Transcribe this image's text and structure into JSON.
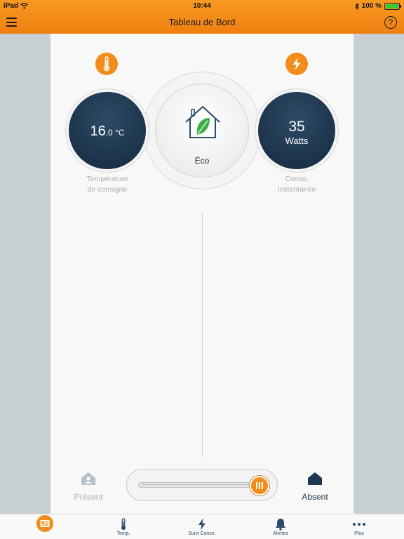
{
  "status_bar": {
    "device": "iPad",
    "time": "10:44",
    "battery": "100 %",
    "battery_level": 1.0
  },
  "nav": {
    "title": "Tableau de Bord",
    "help_symbol": "?",
    "left_icon": "hamburger-menu-icon"
  },
  "dashboard": {
    "temperature": {
      "icon": "thermometer-icon",
      "value_int": "16",
      "value_dec": ".0 °C",
      "caption_line1": "Température",
      "caption_line2": "de consigne"
    },
    "mode": {
      "icon": "eco-house-icon",
      "label": "Éco"
    },
    "consumption": {
      "icon": "lightning-icon",
      "value": "35",
      "unit": "Watts",
      "caption_line1": "Conso.",
      "caption_line2": "Instantanée"
    }
  },
  "presence": {
    "present_label": "Présent",
    "absent_label": "Absent",
    "selected": "Absent",
    "slider_level": 1.0
  },
  "tabs": [
    {
      "label": "",
      "icon": "dashboard-icon",
      "active": true
    },
    {
      "label": "Temp.",
      "icon": "thermometer-icon"
    },
    {
      "label": "Suivi Conso.",
      "icon": "lightning-icon"
    },
    {
      "label": "Alertes",
      "icon": "bell-icon"
    },
    {
      "label": "Plus",
      "icon": "more-dots-icon"
    }
  ],
  "colors": {
    "accent": "#f28c1a",
    "navy": "#1f3850",
    "eco_green": "#3cae49",
    "muted_text": "#a9aeb2"
  }
}
